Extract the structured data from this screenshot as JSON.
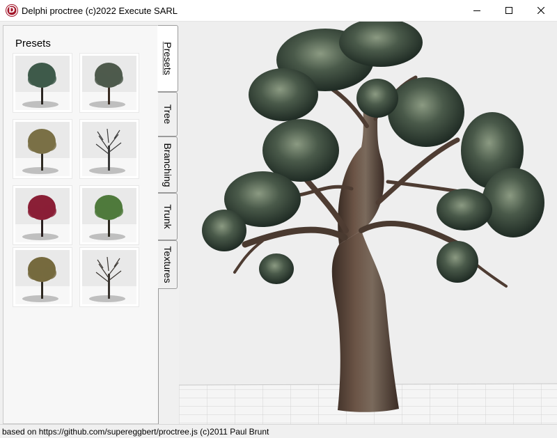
{
  "window": {
    "title": "Delphi proctree (c)2022 Execute SARL",
    "icon": "delphi-logo-icon",
    "icon_letter": "D",
    "controls": [
      "minimize-icon",
      "maximize-icon",
      "close-icon"
    ]
  },
  "presets_panel": {
    "title": "Presets",
    "thumbnails": [
      {
        "id": "preset-1",
        "foliage": "#3e5a4a",
        "trunk": "#2b2622"
      },
      {
        "id": "preset-2",
        "foliage": "#4e5a4c",
        "trunk": "#3a2c22"
      },
      {
        "id": "preset-3",
        "foliage": "#7a7046",
        "trunk": "#2e2a22"
      },
      {
        "id": "preset-4",
        "foliage": "",
        "trunk": "#3a3a3a"
      },
      {
        "id": "preset-5",
        "foliage": "#8a1f36",
        "trunk": "#2a2020"
      },
      {
        "id": "preset-6",
        "foliage": "#4f7a3c",
        "trunk": "#2d2a20"
      },
      {
        "id": "preset-7",
        "foliage": "#766a3e",
        "trunk": "#2d2820"
      },
      {
        "id": "preset-8",
        "foliage": "",
        "trunk": "#3a3530"
      }
    ]
  },
  "tabs": [
    {
      "label": "Presets",
      "active": true
    },
    {
      "label": "Tree",
      "active": false
    },
    {
      "label": "Branching",
      "active": false
    },
    {
      "label": "Trunk",
      "active": false
    },
    {
      "label": "Textures",
      "active": false
    }
  ],
  "viewport": {
    "background": "#eeeeee",
    "trunk_color": "#5a4438",
    "foliage_color": "#34443a",
    "ground_grid": true
  },
  "statusbar": {
    "text": "based on https://github.com/supereggbert/proctree.js (c)2011 Paul Brunt"
  }
}
